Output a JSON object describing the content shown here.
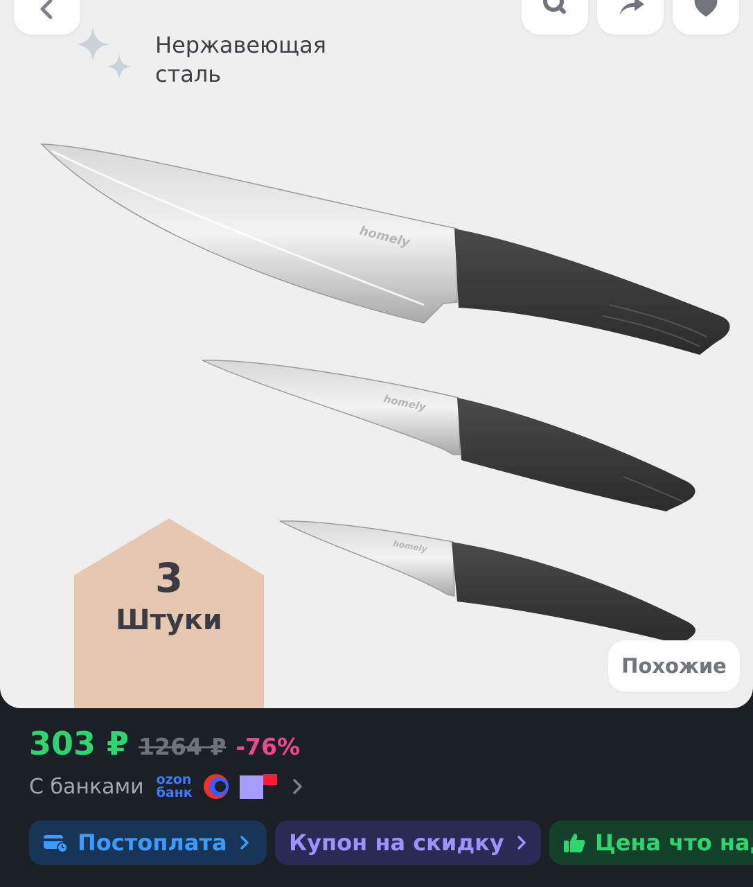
{
  "gallery": {
    "feature_label": "Нержавеющая сталь",
    "brand_mark": "homely",
    "badge": {
      "count": "3",
      "label": "Штуки",
      "color": "#e6c8b0"
    },
    "similar_label": "Похожие"
  },
  "top_bar": {
    "back_icon": "chevron-left-icon",
    "search_icon": "search-icon",
    "share_icon": "share-icon",
    "favorite_icon": "heart-icon"
  },
  "price": {
    "current": "303 ₽",
    "old": "1264 ₽",
    "discount": "-76%"
  },
  "banks": {
    "label": "С банками",
    "ozon_line1": "ozon",
    "ozon_line2": "банк"
  },
  "chips": [
    {
      "label": "Постоплата",
      "icon": "card-clock-icon"
    },
    {
      "label": "Купон на скидку",
      "icon": ""
    },
    {
      "label": "Цена что надо",
      "icon": "thumbs-up-icon"
    }
  ],
  "colors": {
    "price_green": "#2ed66f",
    "discount_pink": "#f2478d",
    "background_dark": "#1b1f26"
  }
}
